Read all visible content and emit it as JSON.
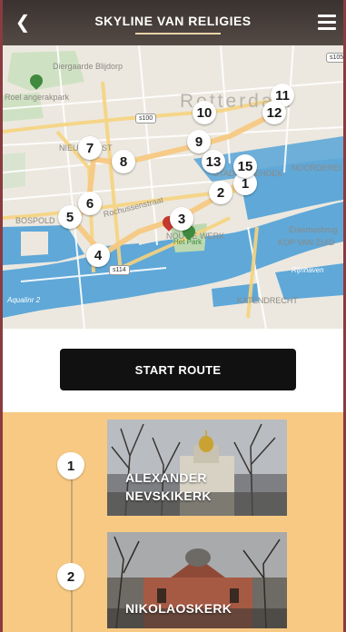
{
  "header": {
    "title": "SKYLINE VAN RELIGIES",
    "back_icon": "chevron-left-icon",
    "menu_icon": "hamburger-menu-icon"
  },
  "map": {
    "city_label": "Rotterdam",
    "labels": [
      "Diergaarde Blijdorp",
      "Roel angerakpark",
      "NIEUW WEST",
      "BOSPOLD",
      "NOORDEREI",
      "Erasmusbrug",
      "KOP VAN ZUID",
      "Rijnhaven",
      "KATENDRECHT",
      "STADSDRIEHOEK",
      "Het Park",
      "Aqualinr 2",
      "Rochussenstraat",
      "NOUWE WERK"
    ],
    "shields": [
      "s100",
      "s105",
      "s114"
    ],
    "markers": [
      "1",
      "2",
      "3",
      "4",
      "5",
      "6",
      "7",
      "8",
      "9",
      "10",
      "11",
      "12",
      "13",
      "15"
    ],
    "colors": {
      "water": "#5fa8d8",
      "land": "#ece8df",
      "route": "#f7c982"
    }
  },
  "start_button": {
    "label": "START ROUTE"
  },
  "stops": [
    {
      "number": "1",
      "name_line1": "ALEXANDER",
      "name_line2": "NEVSKIKERK"
    },
    {
      "number": "2",
      "name_line1": "NIKOLAOSKERK",
      "name_line2": ""
    }
  ],
  "theme": {
    "accent": "#f7c982",
    "header_bg": "#3a3230",
    "button_bg": "#111111"
  }
}
